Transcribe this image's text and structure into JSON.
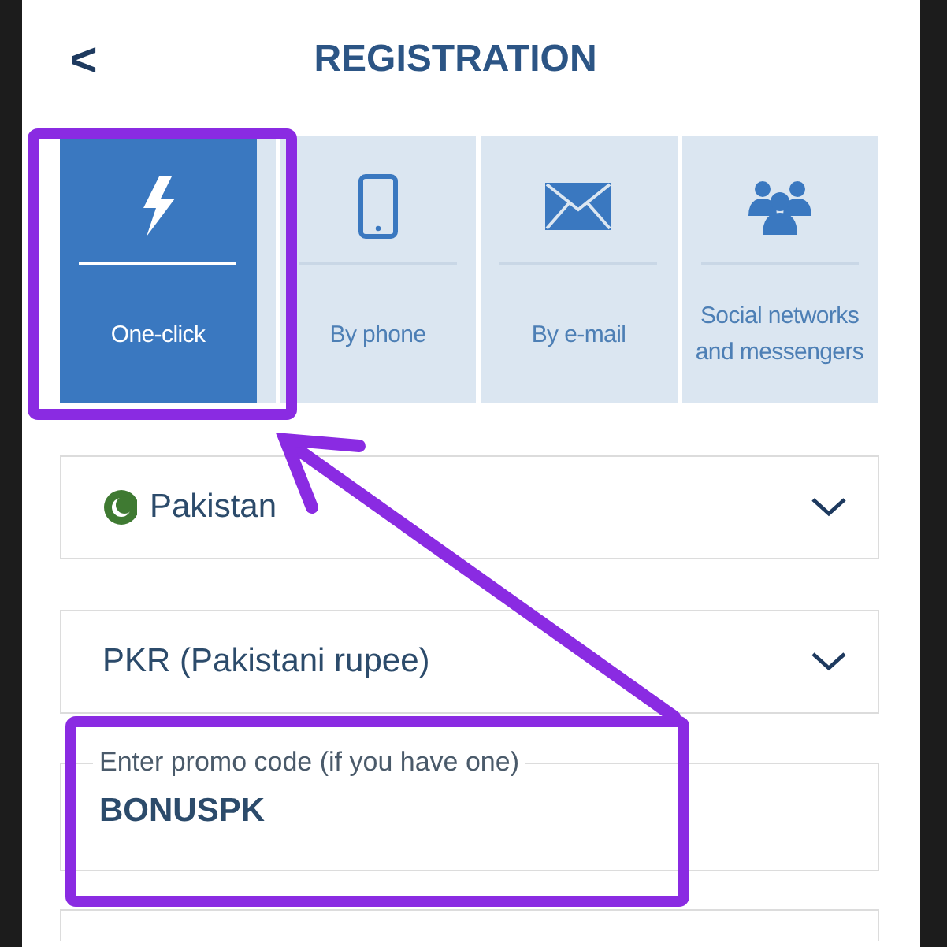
{
  "header": {
    "back": "<",
    "title": "REGISTRATION"
  },
  "tabs": [
    {
      "label": "One-click",
      "selected": true
    },
    {
      "label": "By phone",
      "selected": false
    },
    {
      "label": "By e-mail",
      "selected": false
    },
    {
      "label": "Social networks and messengers",
      "selected": false
    }
  ],
  "fields": [
    {
      "kind": "select",
      "value": "Pakistan",
      "flag": true
    },
    {
      "kind": "select",
      "value": "PKR (Pakistani rupee)",
      "flag": false
    },
    {
      "kind": "text",
      "placeholder": "Enter promo code (if you have one)",
      "value": "BONUSPK"
    }
  ]
}
